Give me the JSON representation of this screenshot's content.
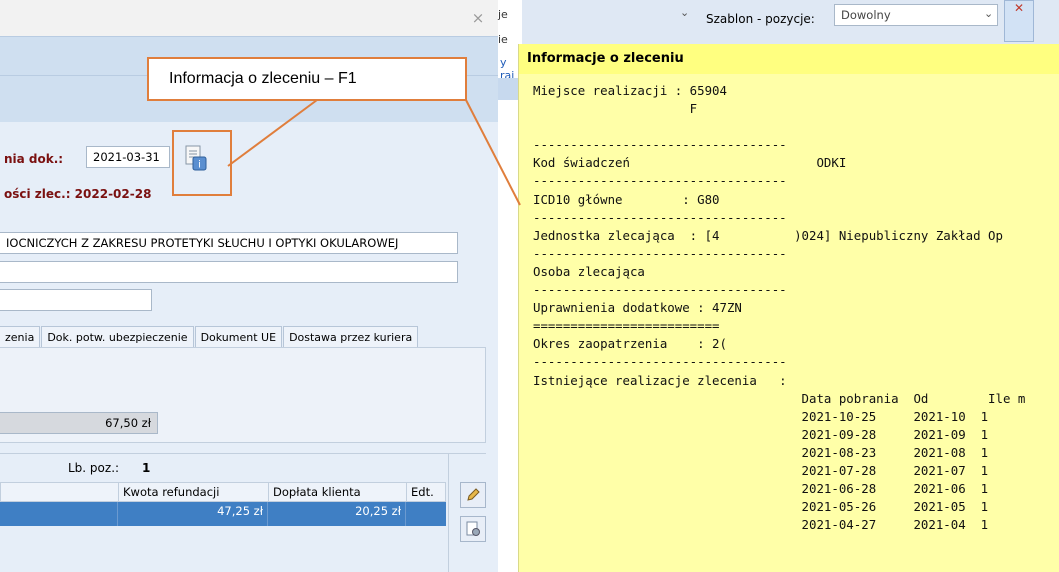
{
  "dialog": {
    "close_glyph": "×",
    "doc_date_label": "nia dok.:",
    "doc_date_value": "2021-03-31",
    "valid_until_label": "ości zlec.: 2022-02-28",
    "product_desc": "IOCNICZYCH Z ZAKRESU PROTETYKI SŁUCHU I OPTYKI OKULAROWEJ",
    "tabs": [
      "zenia",
      "Dok. potw. ubezpieczenie",
      "Dokument UE",
      "Dostawa przez kuriera"
    ],
    "amount": "67,50 zł",
    "lbpoz_label": "Lb. poz.:",
    "lbpoz_value": "1",
    "grid_headers": [
      "Kwota refundacji",
      "Dopłata klienta",
      "Edt."
    ],
    "grid_row": [
      "47,25 zł",
      "20,25 zł",
      ""
    ]
  },
  "callout": {
    "text": "Informacja o zleceniu – F1"
  },
  "background_window": {
    "fragments": [
      "je",
      "ie",
      "y raj"
    ],
    "template_label": "Szablon - pozycje:",
    "template_value": "Dowolny",
    "chevrons": [
      "⌄",
      "⌄"
    ]
  },
  "info_panel": {
    "title": "Informacje o zleceniu",
    "lines": [
      "Miejsce realizacji : 65904",
      "                     F",
      "",
      "----------------------------------",
      "Kod świadczeń                         ODKI",
      "----------------------------------",
      "ICD10 główne        : G80",
      "----------------------------------",
      "Jednostka zlecająca  : [4          )024] Niepubliczny Zakład Op",
      "----------------------------------",
      "Osoba zlecająca",
      "----------------------------------",
      "Uprawnienia dodatkowe : 47ZN",
      "=========================",
      "Okres zaopatrzenia    : 2(",
      "----------------------------------",
      "Istniejące realizacje zlecenia   :",
      "                                    Data pobrania  Od        Ile m",
      "                                    2021-10-25     2021-10  1",
      "                                    2021-09-28     2021-09  1",
      "                                    2021-08-23     2021-08  1",
      "                                    2021-07-28     2021-07  1",
      "                                    2021-06-28     2021-06  1",
      "                                    2021-05-26     2021-05  1",
      "                                    2021-04-27     2021-04  1"
    ]
  },
  "colors": {
    "callout_border": "#e07e3c",
    "panel_bg": "#ffffa8",
    "panel_title_bg": "#ffff80",
    "selected_row": "#3f7fc4",
    "label_red": "#7a1010"
  }
}
